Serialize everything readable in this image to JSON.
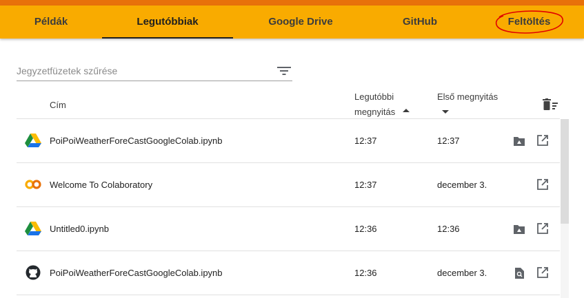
{
  "colors": {
    "tabbar": "#f9ab00",
    "top_strip": "#e8710a",
    "annotation_circle": "#e00000"
  },
  "tabs": [
    {
      "label": "Példák",
      "active": false
    },
    {
      "label": "Legutóbbiak",
      "active": true
    },
    {
      "label": "Google Drive",
      "active": false
    },
    {
      "label": "GitHub",
      "active": false
    },
    {
      "label": "Feltöltés",
      "active": false,
      "annotated": true
    }
  ],
  "filter": {
    "placeholder": "Jegyzetfüzetek szűrése",
    "value": "",
    "icon": "filter-list-icon"
  },
  "table": {
    "headers": {
      "title": "Cím",
      "last_opened_line1": "Legutóbbi",
      "last_opened_line2": "megnyitás",
      "first_opened": "Első megnyitás"
    },
    "sort": {
      "last_opened": "ascending",
      "first_opened": "descending"
    },
    "rows": [
      {
        "icon": "google-drive-icon",
        "title": "PoiPoiWeatherForeCastGoogleColab.ipynb",
        "last_opened": "12:37",
        "first_opened": "12:37",
        "action_icon": "drive-folder-icon",
        "open_icon": "open-in-new-icon"
      },
      {
        "icon": "colab-logo-icon",
        "title": "Welcome To Colaboratory",
        "last_opened": "12:37",
        "first_opened": "december 3.",
        "action_icon": "",
        "open_icon": "open-in-new-icon"
      },
      {
        "icon": "google-drive-icon",
        "title": "Untitled0.ipynb",
        "last_opened": "12:36",
        "first_opened": "12:36",
        "action_icon": "drive-folder-icon",
        "open_icon": "open-in-new-icon"
      },
      {
        "icon": "github-icon",
        "title": "PoiPoiWeatherForeCastGoogleColab.ipynb",
        "last_opened": "12:36",
        "first_opened": "december 3.",
        "action_icon": "find-in-page-icon",
        "open_icon": "open-in-new-icon"
      }
    ]
  }
}
